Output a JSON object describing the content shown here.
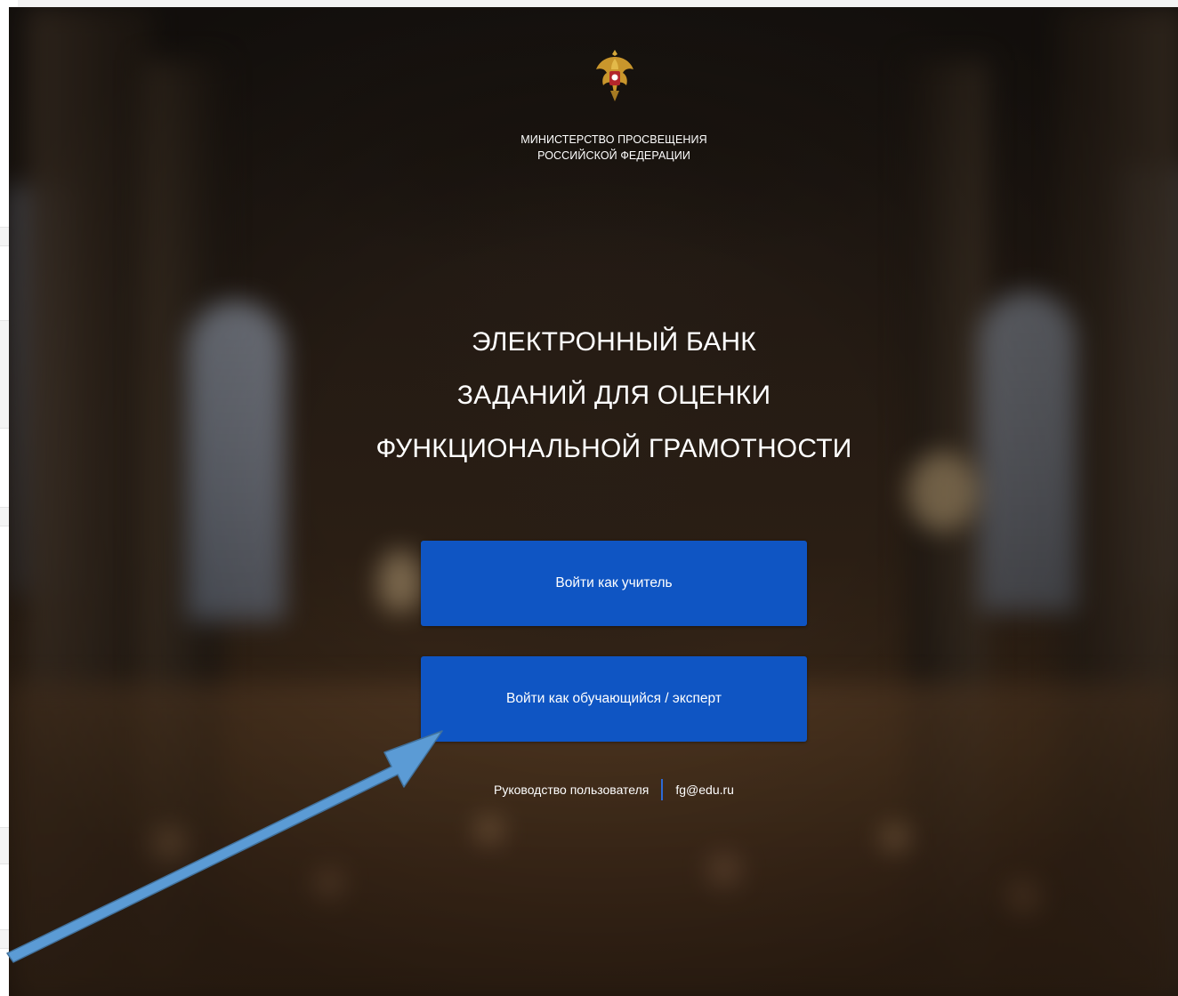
{
  "header": {
    "ministry_line1": "МИНИСТЕРСТВО ПРОСВЕЩЕНИЯ",
    "ministry_line2": "РОССИЙСКОЙ ФЕДЕРАЦИИ",
    "emblem_icon": "coat-of-arms-icon"
  },
  "main": {
    "title_line1": "ЭЛЕКТРОННЫЙ БАНК",
    "title_line2": "ЗАДАНИЙ ДЛЯ ОЦЕНКИ",
    "title_line3": "ФУНКЦИОНАЛЬНОЙ ГРАМОТНОСТИ",
    "login_teacher_label": "Войти как учитель",
    "login_student_label": "Войти как обучающийся / эксперт"
  },
  "footer": {
    "user_guide_link": "Руководство пользователя",
    "email_link": "fg@edu.ru"
  },
  "colors": {
    "button_bg": "#0f55c3",
    "separator": "#2d6ad6",
    "annotation_arrow": "#5b9bd5"
  },
  "annotation": {
    "arrow_icon": "pointer-arrow-icon"
  }
}
